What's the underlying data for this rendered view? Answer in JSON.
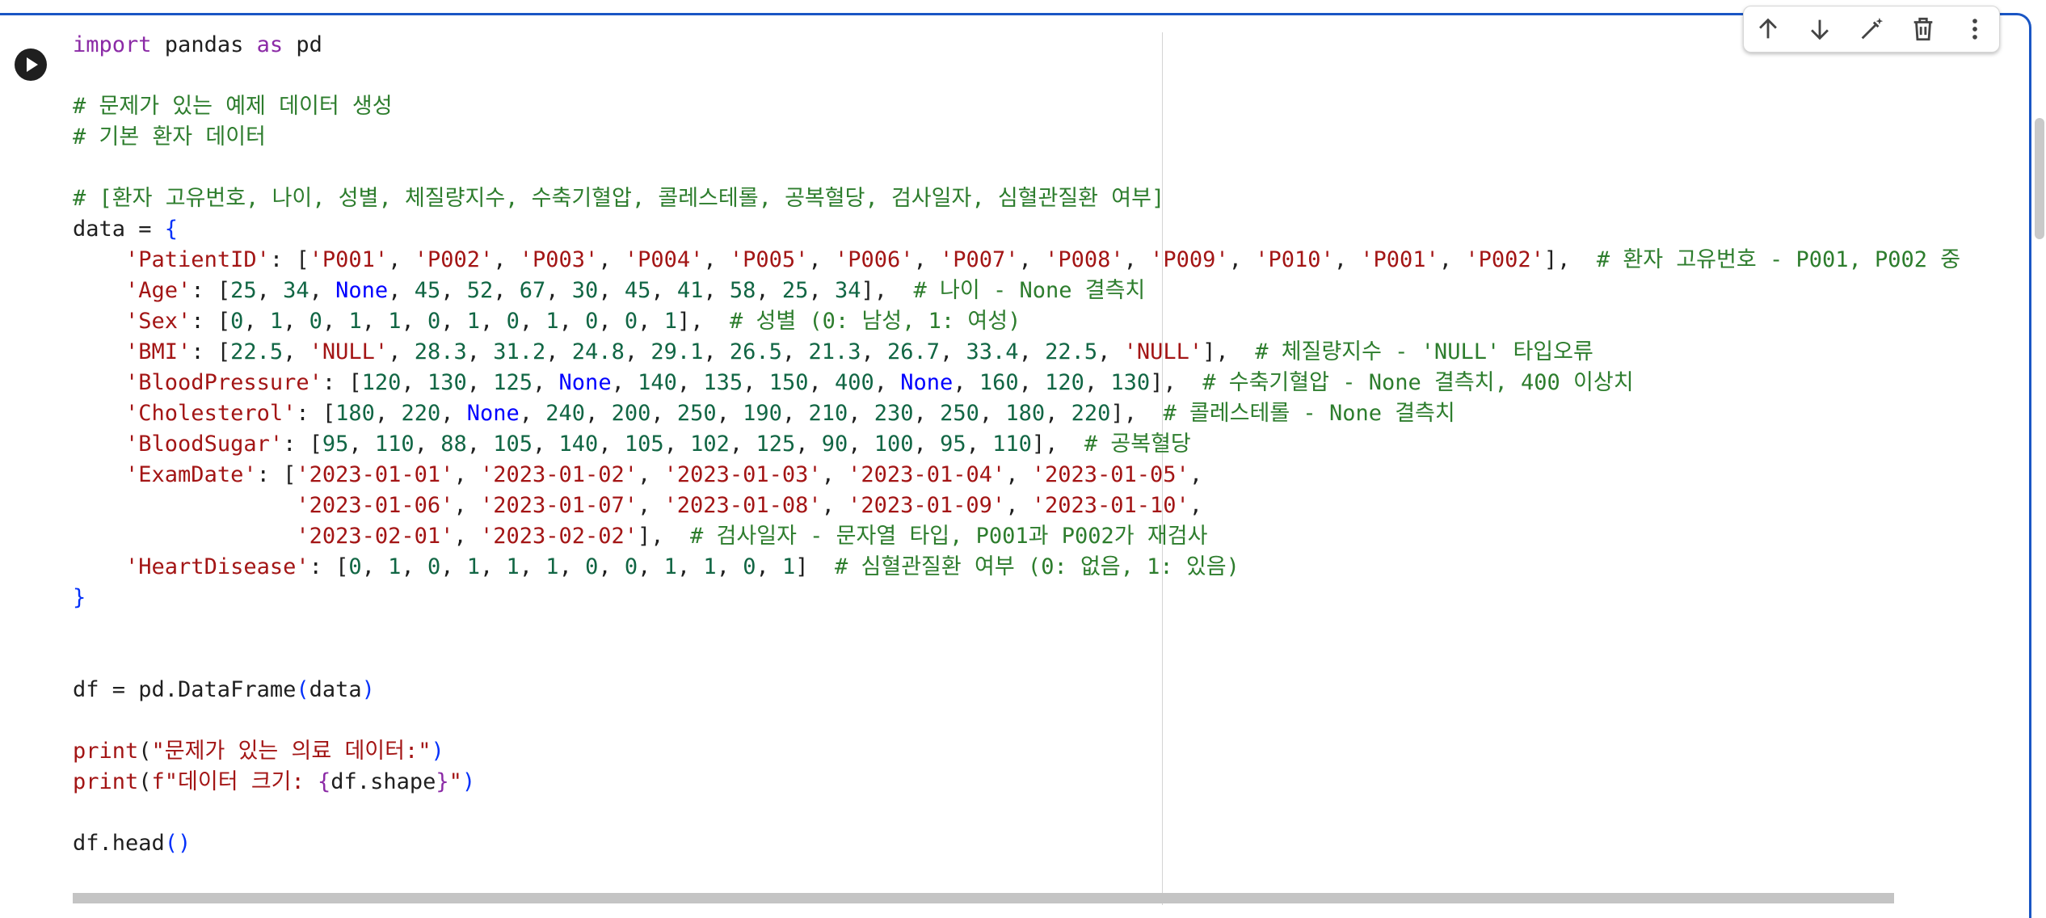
{
  "cell": {
    "run_button_icon": "play-icon",
    "toolbar": [
      {
        "name": "move-up-button",
        "icon": "arrow-up-icon"
      },
      {
        "name": "move-down-button",
        "icon": "arrow-down-icon"
      },
      {
        "name": "edit-button",
        "icon": "magic-wand-icon"
      },
      {
        "name": "delete-button",
        "icon": "trash-icon"
      },
      {
        "name": "more-options-button",
        "icon": "more-vert-icon"
      }
    ],
    "code_lines": [
      [
        {
          "t": "import",
          "c": "kw"
        },
        {
          "t": " pandas "
        },
        {
          "t": "as",
          "c": "kw"
        },
        {
          "t": " pd"
        }
      ],
      [],
      [
        {
          "t": "# 문제가 있는 예제 데이터 생성",
          "c": "cm"
        }
      ],
      [
        {
          "t": "# 기본 환자 데이터",
          "c": "cm"
        }
      ],
      [],
      [
        {
          "t": "# [환자 고유번호, 나이, 성별, 체질량지수, 수축기혈압, 콜레스테롤, 공복혈당, 검사일자, 심혈관질환 여부]",
          "c": "cm"
        }
      ],
      [
        {
          "t": "data = "
        },
        {
          "t": "{",
          "c": "br"
        }
      ],
      [
        {
          "t": "    "
        },
        {
          "t": "'PatientID'",
          "c": "st"
        },
        {
          "t": ": ["
        },
        {
          "t": "'P001'",
          "c": "st"
        },
        {
          "t": ", "
        },
        {
          "t": "'P002'",
          "c": "st"
        },
        {
          "t": ", "
        },
        {
          "t": "'P003'",
          "c": "st"
        },
        {
          "t": ", "
        },
        {
          "t": "'P004'",
          "c": "st"
        },
        {
          "t": ", "
        },
        {
          "t": "'P005'",
          "c": "st"
        },
        {
          "t": ", "
        },
        {
          "t": "'P006'",
          "c": "st"
        },
        {
          "t": ", "
        },
        {
          "t": "'P007'",
          "c": "st"
        },
        {
          "t": ", "
        },
        {
          "t": "'P008'",
          "c": "st"
        },
        {
          "t": ", "
        },
        {
          "t": "'P009'",
          "c": "st"
        },
        {
          "t": ", "
        },
        {
          "t": "'P010'",
          "c": "st"
        },
        {
          "t": ", "
        },
        {
          "t": "'P001'",
          "c": "st"
        },
        {
          "t": ", "
        },
        {
          "t": "'P002'",
          "c": "st"
        },
        {
          "t": "],  "
        },
        {
          "t": "# 환자 고유번호 - P001, P002 중",
          "c": "cm"
        }
      ],
      [
        {
          "t": "    "
        },
        {
          "t": "'Age'",
          "c": "st"
        },
        {
          "t": ": ["
        },
        {
          "t": "25",
          "c": "nm"
        },
        {
          "t": ", "
        },
        {
          "t": "34",
          "c": "nm"
        },
        {
          "t": ", "
        },
        {
          "t": "None",
          "c": "cn"
        },
        {
          "t": ", "
        },
        {
          "t": "45",
          "c": "nm"
        },
        {
          "t": ", "
        },
        {
          "t": "52",
          "c": "nm"
        },
        {
          "t": ", "
        },
        {
          "t": "67",
          "c": "nm"
        },
        {
          "t": ", "
        },
        {
          "t": "30",
          "c": "nm"
        },
        {
          "t": ", "
        },
        {
          "t": "45",
          "c": "nm"
        },
        {
          "t": ", "
        },
        {
          "t": "41",
          "c": "nm"
        },
        {
          "t": ", "
        },
        {
          "t": "58",
          "c": "nm"
        },
        {
          "t": ", "
        },
        {
          "t": "25",
          "c": "nm"
        },
        {
          "t": ", "
        },
        {
          "t": "34",
          "c": "nm"
        },
        {
          "t": "],  "
        },
        {
          "t": "# 나이 - None 결측치",
          "c": "cm"
        }
      ],
      [
        {
          "t": "    "
        },
        {
          "t": "'Sex'",
          "c": "st"
        },
        {
          "t": ": ["
        },
        {
          "t": "0",
          "c": "nm"
        },
        {
          "t": ", "
        },
        {
          "t": "1",
          "c": "nm"
        },
        {
          "t": ", "
        },
        {
          "t": "0",
          "c": "nm"
        },
        {
          "t": ", "
        },
        {
          "t": "1",
          "c": "nm"
        },
        {
          "t": ", "
        },
        {
          "t": "1",
          "c": "nm"
        },
        {
          "t": ", "
        },
        {
          "t": "0",
          "c": "nm"
        },
        {
          "t": ", "
        },
        {
          "t": "1",
          "c": "nm"
        },
        {
          "t": ", "
        },
        {
          "t": "0",
          "c": "nm"
        },
        {
          "t": ", "
        },
        {
          "t": "1",
          "c": "nm"
        },
        {
          "t": ", "
        },
        {
          "t": "0",
          "c": "nm"
        },
        {
          "t": ", "
        },
        {
          "t": "0",
          "c": "nm"
        },
        {
          "t": ", "
        },
        {
          "t": "1",
          "c": "nm"
        },
        {
          "t": "],  "
        },
        {
          "t": "# 성별 (0: 남성, 1: 여성)",
          "c": "cm"
        }
      ],
      [
        {
          "t": "    "
        },
        {
          "t": "'BMI'",
          "c": "st"
        },
        {
          "t": ": ["
        },
        {
          "t": "22.5",
          "c": "nm"
        },
        {
          "t": ", "
        },
        {
          "t": "'NULL'",
          "c": "st"
        },
        {
          "t": ", "
        },
        {
          "t": "28.3",
          "c": "nm"
        },
        {
          "t": ", "
        },
        {
          "t": "31.2",
          "c": "nm"
        },
        {
          "t": ", "
        },
        {
          "t": "24.8",
          "c": "nm"
        },
        {
          "t": ", "
        },
        {
          "t": "29.1",
          "c": "nm"
        },
        {
          "t": ", "
        },
        {
          "t": "26.5",
          "c": "nm"
        },
        {
          "t": ", "
        },
        {
          "t": "21.3",
          "c": "nm"
        },
        {
          "t": ", "
        },
        {
          "t": "26.7",
          "c": "nm"
        },
        {
          "t": ", "
        },
        {
          "t": "33.4",
          "c": "nm"
        },
        {
          "t": ", "
        },
        {
          "t": "22.5",
          "c": "nm"
        },
        {
          "t": ", "
        },
        {
          "t": "'NULL'",
          "c": "st"
        },
        {
          "t": "],  "
        },
        {
          "t": "# 체질량지수 - 'NULL' 타입오류",
          "c": "cm"
        }
      ],
      [
        {
          "t": "    "
        },
        {
          "t": "'BloodPressure'",
          "c": "st"
        },
        {
          "t": ": ["
        },
        {
          "t": "120",
          "c": "nm"
        },
        {
          "t": ", "
        },
        {
          "t": "130",
          "c": "nm"
        },
        {
          "t": ", "
        },
        {
          "t": "125",
          "c": "nm"
        },
        {
          "t": ", "
        },
        {
          "t": "None",
          "c": "cn"
        },
        {
          "t": ", "
        },
        {
          "t": "140",
          "c": "nm"
        },
        {
          "t": ", "
        },
        {
          "t": "135",
          "c": "nm"
        },
        {
          "t": ", "
        },
        {
          "t": "150",
          "c": "nm"
        },
        {
          "t": ", "
        },
        {
          "t": "400",
          "c": "nm"
        },
        {
          "t": ", "
        },
        {
          "t": "None",
          "c": "cn"
        },
        {
          "t": ", "
        },
        {
          "t": "160",
          "c": "nm"
        },
        {
          "t": ", "
        },
        {
          "t": "120",
          "c": "nm"
        },
        {
          "t": ", "
        },
        {
          "t": "130",
          "c": "nm"
        },
        {
          "t": "],  "
        },
        {
          "t": "# 수축기혈압 - None 결측치, 400 이상치",
          "c": "cm"
        }
      ],
      [
        {
          "t": "    "
        },
        {
          "t": "'Cholesterol'",
          "c": "st"
        },
        {
          "t": ": ["
        },
        {
          "t": "180",
          "c": "nm"
        },
        {
          "t": ", "
        },
        {
          "t": "220",
          "c": "nm"
        },
        {
          "t": ", "
        },
        {
          "t": "None",
          "c": "cn"
        },
        {
          "t": ", "
        },
        {
          "t": "240",
          "c": "nm"
        },
        {
          "t": ", "
        },
        {
          "t": "200",
          "c": "nm"
        },
        {
          "t": ", "
        },
        {
          "t": "250",
          "c": "nm"
        },
        {
          "t": ", "
        },
        {
          "t": "190",
          "c": "nm"
        },
        {
          "t": ", "
        },
        {
          "t": "210",
          "c": "nm"
        },
        {
          "t": ", "
        },
        {
          "t": "230",
          "c": "nm"
        },
        {
          "t": ", "
        },
        {
          "t": "250",
          "c": "nm"
        },
        {
          "t": ", "
        },
        {
          "t": "180",
          "c": "nm"
        },
        {
          "t": ", "
        },
        {
          "t": "220",
          "c": "nm"
        },
        {
          "t": "],  "
        },
        {
          "t": "# 콜레스테롤 - None 결측치",
          "c": "cm"
        }
      ],
      [
        {
          "t": "    "
        },
        {
          "t": "'BloodSugar'",
          "c": "st"
        },
        {
          "t": ": ["
        },
        {
          "t": "95",
          "c": "nm"
        },
        {
          "t": ", "
        },
        {
          "t": "110",
          "c": "nm"
        },
        {
          "t": ", "
        },
        {
          "t": "88",
          "c": "nm"
        },
        {
          "t": ", "
        },
        {
          "t": "105",
          "c": "nm"
        },
        {
          "t": ", "
        },
        {
          "t": "140",
          "c": "nm"
        },
        {
          "t": ", "
        },
        {
          "t": "105",
          "c": "nm"
        },
        {
          "t": ", "
        },
        {
          "t": "102",
          "c": "nm"
        },
        {
          "t": ", "
        },
        {
          "t": "125",
          "c": "nm"
        },
        {
          "t": ", "
        },
        {
          "t": "90",
          "c": "nm"
        },
        {
          "t": ", "
        },
        {
          "t": "100",
          "c": "nm"
        },
        {
          "t": ", "
        },
        {
          "t": "95",
          "c": "nm"
        },
        {
          "t": ", "
        },
        {
          "t": "110",
          "c": "nm"
        },
        {
          "t": "],  "
        },
        {
          "t": "# 공복혈당",
          "c": "cm"
        }
      ],
      [
        {
          "t": "    "
        },
        {
          "t": "'ExamDate'",
          "c": "st"
        },
        {
          "t": ": ["
        },
        {
          "t": "'2023-01-01'",
          "c": "st"
        },
        {
          "t": ", "
        },
        {
          "t": "'2023-01-02'",
          "c": "st"
        },
        {
          "t": ", "
        },
        {
          "t": "'2023-01-03'",
          "c": "st"
        },
        {
          "t": ", "
        },
        {
          "t": "'2023-01-04'",
          "c": "st"
        },
        {
          "t": ", "
        },
        {
          "t": "'2023-01-05'",
          "c": "st"
        },
        {
          "t": ","
        }
      ],
      [
        {
          "t": "                 "
        },
        {
          "t": "'2023-01-06'",
          "c": "st"
        },
        {
          "t": ", "
        },
        {
          "t": "'2023-01-07'",
          "c": "st"
        },
        {
          "t": ", "
        },
        {
          "t": "'2023-01-08'",
          "c": "st"
        },
        {
          "t": ", "
        },
        {
          "t": "'2023-01-09'",
          "c": "st"
        },
        {
          "t": ", "
        },
        {
          "t": "'2023-01-10'",
          "c": "st"
        },
        {
          "t": ","
        }
      ],
      [
        {
          "t": "                 "
        },
        {
          "t": "'2023-02-01'",
          "c": "st"
        },
        {
          "t": ", "
        },
        {
          "t": "'2023-02-02'",
          "c": "st"
        },
        {
          "t": "],  "
        },
        {
          "t": "# 검사일자 - 문자열 타입, P001과 P002가 재검사",
          "c": "cm"
        }
      ],
      [
        {
          "t": "    "
        },
        {
          "t": "'HeartDisease'",
          "c": "st"
        },
        {
          "t": ": ["
        },
        {
          "t": "0",
          "c": "nm"
        },
        {
          "t": ", "
        },
        {
          "t": "1",
          "c": "nm"
        },
        {
          "t": ", "
        },
        {
          "t": "0",
          "c": "nm"
        },
        {
          "t": ", "
        },
        {
          "t": "1",
          "c": "nm"
        },
        {
          "t": ", "
        },
        {
          "t": "1",
          "c": "nm"
        },
        {
          "t": ", "
        },
        {
          "t": "1",
          "c": "nm"
        },
        {
          "t": ", "
        },
        {
          "t": "0",
          "c": "nm"
        },
        {
          "t": ", "
        },
        {
          "t": "0",
          "c": "nm"
        },
        {
          "t": ", "
        },
        {
          "t": "1",
          "c": "nm"
        },
        {
          "t": ", "
        },
        {
          "t": "1",
          "c": "nm"
        },
        {
          "t": ", "
        },
        {
          "t": "0",
          "c": "nm"
        },
        {
          "t": ", "
        },
        {
          "t": "1",
          "c": "nm"
        },
        {
          "t": "]  "
        },
        {
          "t": "# 심혈관질환 여부 (0: 없음, 1: 있음)",
          "c": "cm"
        }
      ],
      [
        {
          "t": "}",
          "c": "br"
        }
      ],
      [],
      [],
      [
        {
          "t": "df = pd.DataFrame"
        },
        {
          "t": "(",
          "c": "br"
        },
        {
          "t": "data"
        },
        {
          "t": ")",
          "c": "br"
        }
      ],
      [],
      [
        {
          "t": "print",
          "c": "st"
        },
        {
          "t": "("
        },
        {
          "t": "\"문제가 있는 의료 데이터:\"",
          "c": "st"
        },
        {
          "t": ")",
          "c": "br"
        }
      ],
      [
        {
          "t": "print",
          "c": "st"
        },
        {
          "t": "("
        },
        {
          "t": "f\"데이터 크기: ",
          "c": "st"
        },
        {
          "t": "{",
          "c": "kw"
        },
        {
          "t": "df.shape"
        },
        {
          "t": "}",
          "c": "kw"
        },
        {
          "t": "\"",
          "c": "st"
        },
        {
          "t": ")",
          "c": "br"
        }
      ],
      [],
      [
        {
          "t": "df.head"
        },
        {
          "t": "()",
          "c": "br"
        }
      ]
    ]
  }
}
